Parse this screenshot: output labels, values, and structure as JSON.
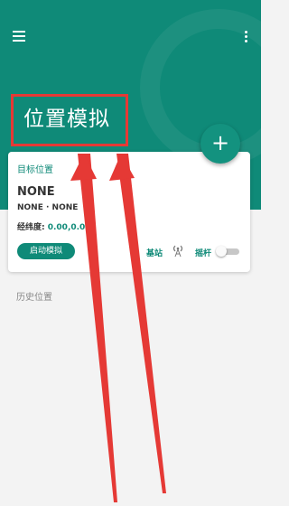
{
  "header": {
    "menu_icon": "hamburger-menu-icon",
    "more_icon": "more-vertical-icon",
    "title": "位置模拟",
    "add_icon": "plus-icon",
    "add_label": "+"
  },
  "card": {
    "label": "目标位置",
    "name": "NONE",
    "subtitle": "NONE · NONE",
    "coord_label": "经纬度: ",
    "coord_value": "0.00,0.00",
    "start_button": "启动模拟",
    "base_station_label": "基站",
    "base_station_icon": "antenna-signal-icon",
    "joystick_label": "摇杆",
    "joystick_enabled": false
  },
  "history": {
    "label": "历史位置"
  },
  "colors": {
    "primary": "#0f8a78",
    "annotation": "#e53935",
    "background": "#f3f3f3"
  }
}
